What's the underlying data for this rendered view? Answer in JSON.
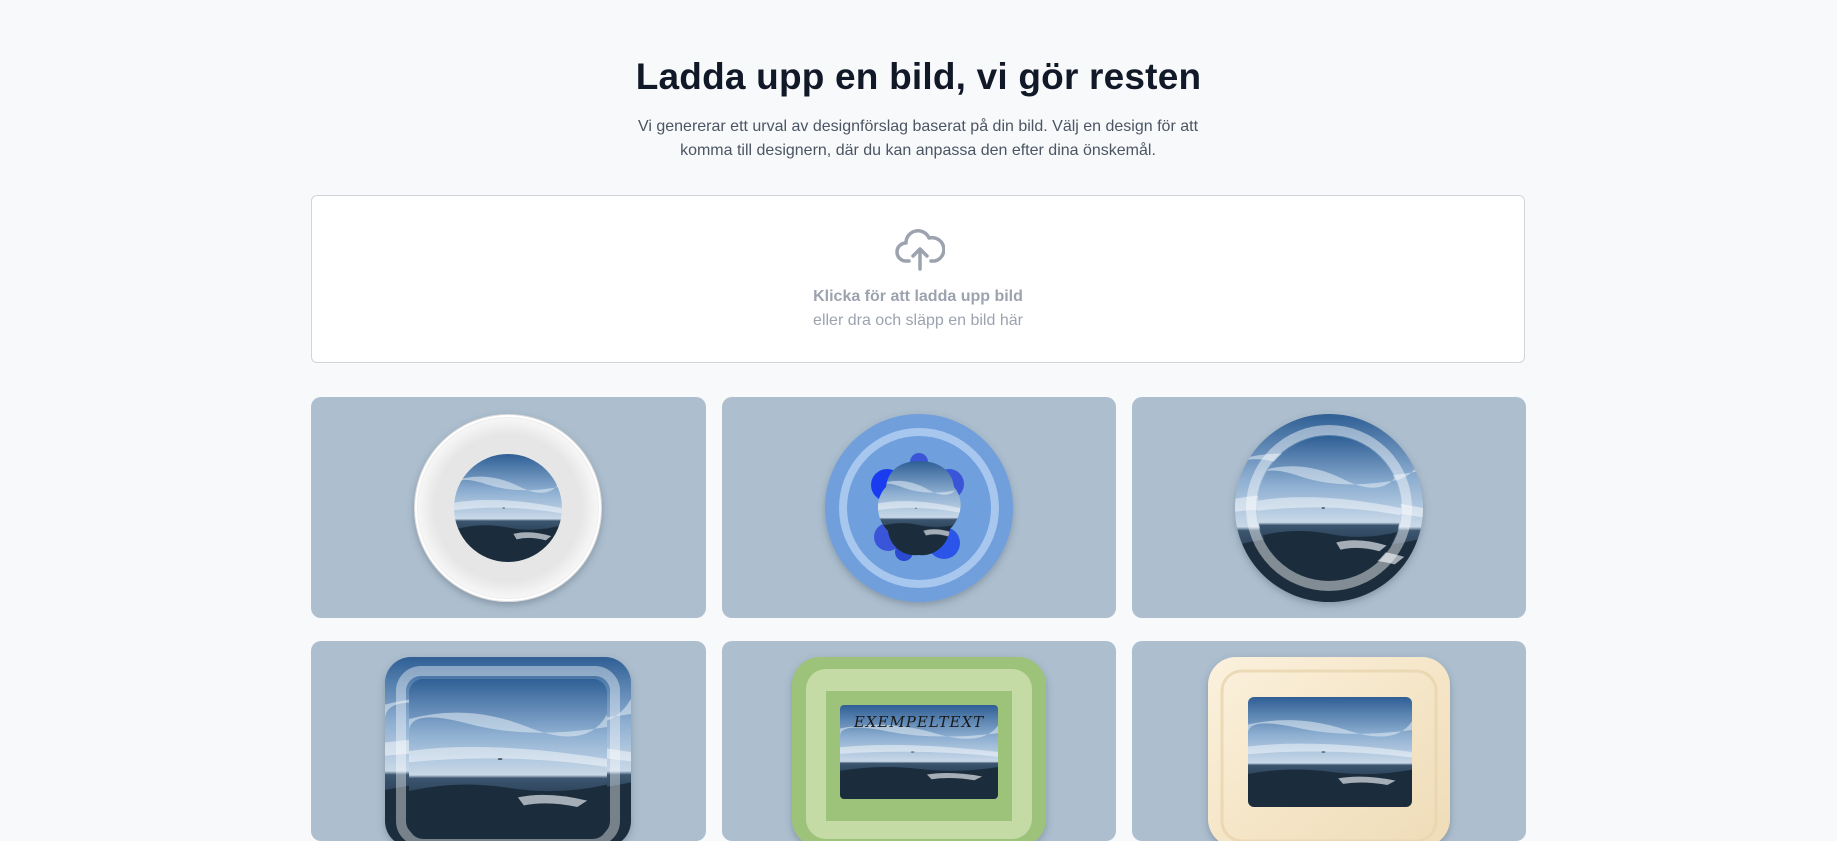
{
  "header": {
    "title": "Ladda upp en bild, vi gör resten",
    "subtitle": "Vi genererar ett urval av designförslag baserat på din bild. Välj en design för att komma till designern, där du kan anpassa den efter dina önskemål."
  },
  "upload": {
    "icon": "cloud-upload-icon",
    "primary_label": "Klicka för att ladda upp bild",
    "secondary_label": "eller dra och släpp en bild här"
  },
  "colors": {
    "card_background": "#adbfcf",
    "green_frame": "#9dc37a",
    "blue_frame": "#6f9fdc"
  },
  "designs": [
    {
      "shape": "round",
      "style": "white-ring"
    },
    {
      "shape": "round",
      "style": "blue-ring-flower"
    },
    {
      "shape": "round",
      "style": "photo-ring"
    },
    {
      "shape": "rectangular",
      "style": "photo-frame"
    },
    {
      "shape": "rectangular",
      "style": "green-frame",
      "sample_text": "EXEMPELTEXT"
    },
    {
      "shape": "rectangular",
      "style": "wood-frame"
    }
  ]
}
